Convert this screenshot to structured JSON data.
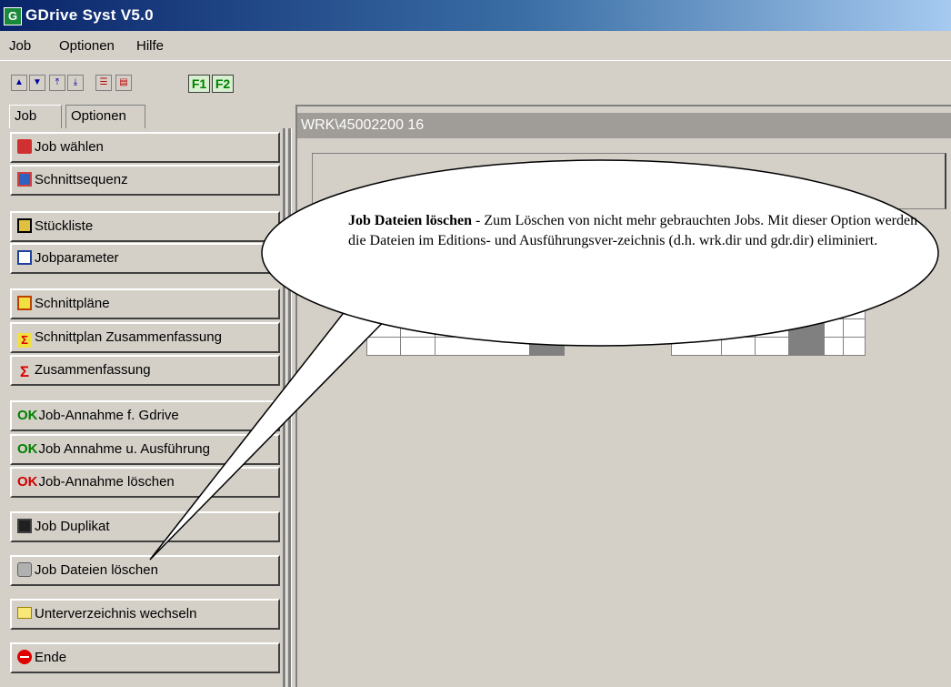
{
  "window": {
    "title": "GDrive Syst V5.0",
    "icon": "G"
  },
  "menu": [
    "Job",
    "Optionen",
    "Hilfe"
  ],
  "toolbar": {
    "f1": "F1",
    "f2": "F2"
  },
  "tabs": [
    "Job",
    "Optionen"
  ],
  "buttons": [
    {
      "label": "Job wählen",
      "icon": "job-select-icon"
    },
    {
      "label": "Schnittsequenz",
      "icon": "cut-sequence-icon"
    },
    {
      "label": "Stückliste",
      "icon": "parts-list-icon"
    },
    {
      "label": "Jobparameter",
      "icon": "job-parameter-icon"
    },
    {
      "label": "Schnittpläne",
      "icon": "cut-plans-icon"
    },
    {
      "label": "Schnittplan Zusammenfassung",
      "icon": "cut-plan-summary-icon"
    },
    {
      "label": "Zusammenfassung",
      "icon": "sigma-icon"
    },
    {
      "label": "Job-Annahme f. Gdrive",
      "icon": "ok-icon",
      "glyph": "OK"
    },
    {
      "label": "Job Annahme u. Ausführung",
      "icon": "ok-run-icon",
      "glyph": "OK"
    },
    {
      "label": "Job-Annahme löschen",
      "icon": "ok-delete-icon",
      "glyph": "OK"
    },
    {
      "label": "Job Duplikat",
      "icon": "floppy-icon"
    },
    {
      "label": "Job Dateien löschen",
      "icon": "recycle-bin-icon"
    },
    {
      "label": "Unterverzeichnis wechseln",
      "icon": "folder-icon"
    },
    {
      "label": "Ende",
      "icon": "exit-icon"
    }
  ],
  "workarea": {
    "path": "WRK\\45002200   16"
  },
  "callout": {
    "title": "Job Dateien löschen",
    "text": " - Zum Löschen von nicht mehr gebrauchten Jobs. Mit dieser Option werden die Dateien im Editions- und Ausführungsver-zeichnis (d.h. wrk.dir und gdr.dir) eliminiert."
  },
  "colors": {
    "titlebar": "#0a246a",
    "accent_green": "#008000",
    "sigma_red": "#e00000"
  }
}
